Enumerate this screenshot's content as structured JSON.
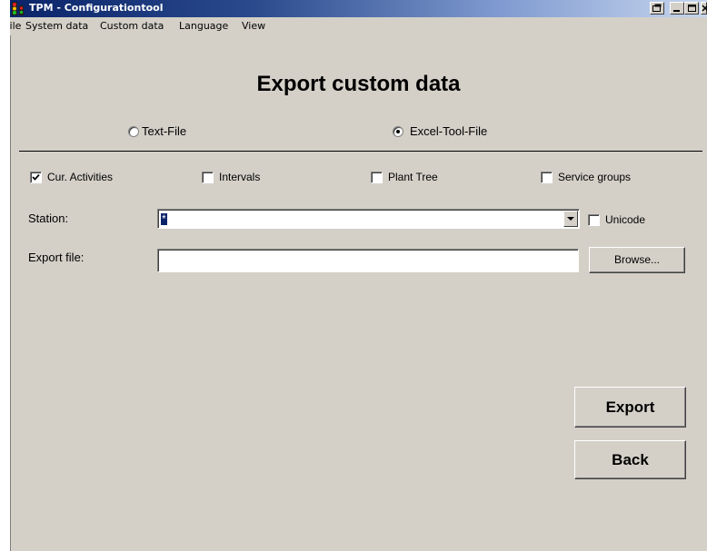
{
  "window": {
    "title": "TPM - Configurationtool"
  },
  "menu": [
    "File",
    "System data",
    "Custom data",
    "Language",
    "View"
  ],
  "page": {
    "heading": "Export custom data"
  },
  "format": {
    "text_label": "Text-File",
    "excel_label": "Excel-Tool-File",
    "selected": "Excel-Tool-File"
  },
  "options": [
    {
      "label": "Cur. Activities",
      "checked": true
    },
    {
      "label": "Intervals",
      "checked": false
    },
    {
      "label": "Plant Tree",
      "checked": false
    },
    {
      "label": "Service groups",
      "checked": false
    }
  ],
  "station": {
    "label": "Station:",
    "value": "*",
    "unicode_label": "Unicode",
    "unicode_checked": false
  },
  "export_file": {
    "label": "Export file:",
    "value": "",
    "browse_label": "Browse..."
  },
  "actions": {
    "export_label": "Export",
    "back_label": "Back"
  },
  "colors": {
    "titlebar_start": "#0a246a",
    "face": "#d4d0c8",
    "selection": "#0a246a"
  },
  "icons": {
    "app": "traffic-light-icon",
    "titlebar": [
      "restore-icon",
      "minimize-icon",
      "maximize-icon",
      "close-icon"
    ]
  }
}
